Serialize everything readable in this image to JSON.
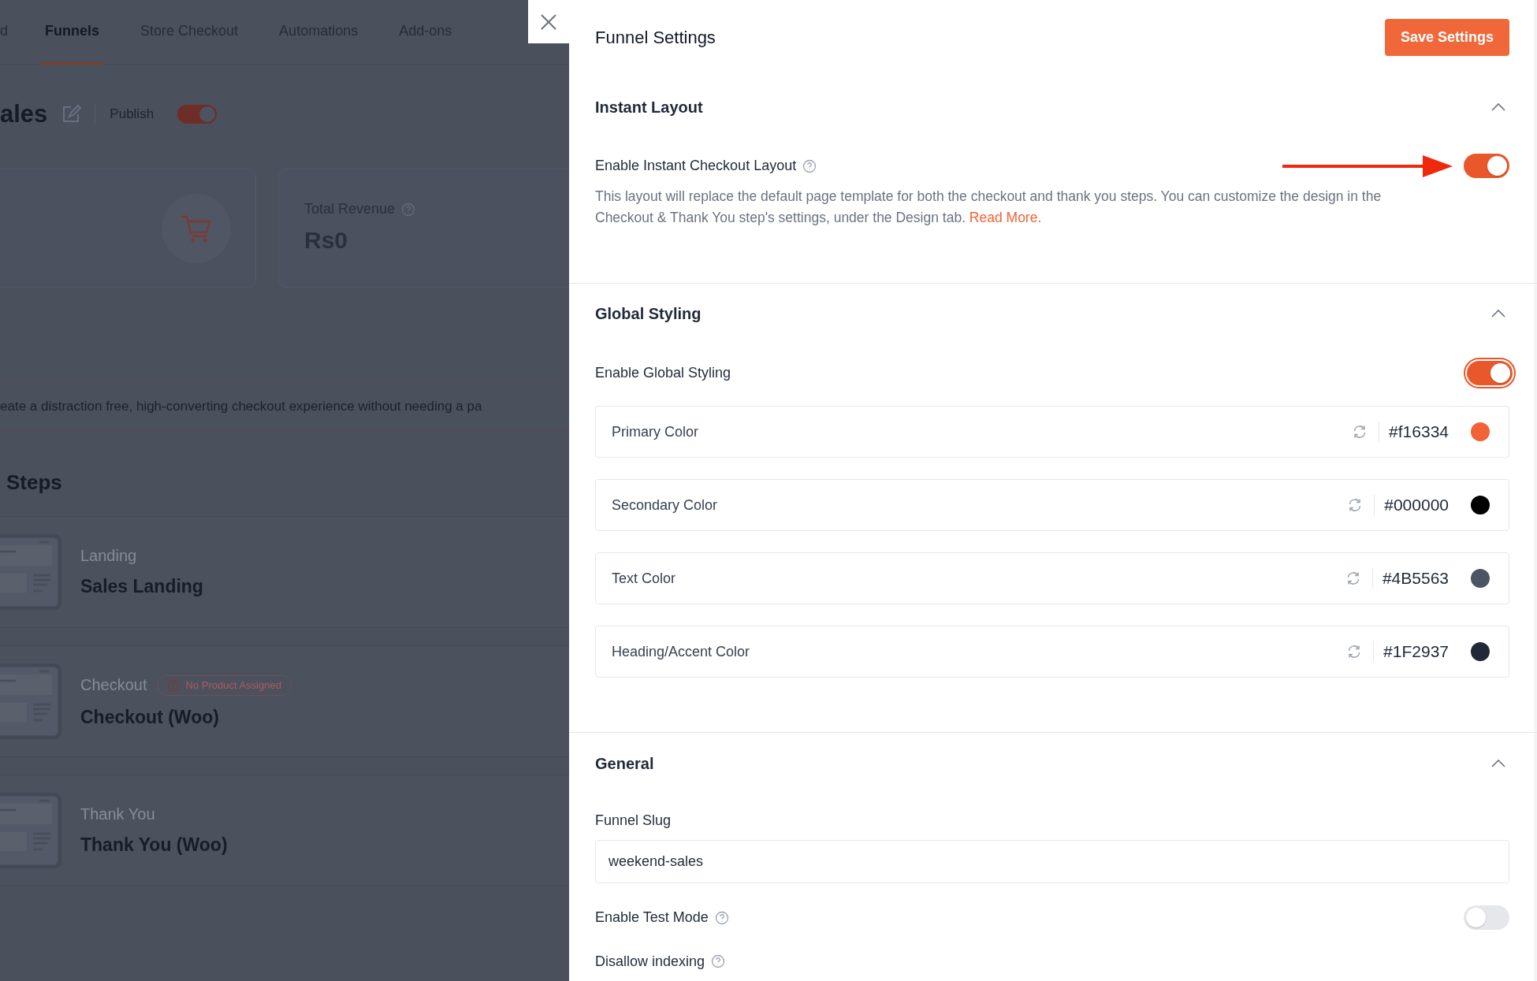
{
  "background_page": {
    "tabs": [
      {
        "label": "d",
        "selected": false
      },
      {
        "label": "Funnels",
        "selected": true
      },
      {
        "label": "Store Checkout",
        "selected": false
      },
      {
        "label": "Automations",
        "selected": false
      },
      {
        "label": "Add-ons",
        "selected": false
      }
    ],
    "funnel_title": "ales",
    "publish_label": "Publish",
    "publish_on": true,
    "stats": [
      {
        "label": "Total Revenue",
        "value": "Rs0"
      }
    ],
    "notice": "eate a distraction free, high-converting checkout experience without needing a pa",
    "steps_heading": "Steps",
    "steps": [
      {
        "type": "Landing",
        "name": "Sales Landing"
      },
      {
        "type": "Checkout",
        "badge": "No Product Assigned",
        "name": "Checkout (Woo)"
      },
      {
        "type": "Thank You",
        "name": "Thank You (Woo)"
      }
    ]
  },
  "panel": {
    "title": "Funnel Settings",
    "save_button": "Save Settings",
    "instant_layout": {
      "title": "Instant Layout",
      "expanded": true,
      "toggle_label": "Enable Instant Checkout Layout",
      "on": true,
      "pointer_arrow": true,
      "description": "This layout will replace the default page template for both the checkout and thank you steps. You can customize the design in the Checkout & Thank You step's settings, under the Design tab.",
      "link": "Read More."
    },
    "global_styling": {
      "title": "Global Styling",
      "expanded": true,
      "toggle_label": "Enable Global Styling",
      "on": true,
      "focused": true,
      "colors": [
        {
          "label": "Primary Color",
          "value": "#f16334",
          "color": "#f16334"
        },
        {
          "label": "Secondary Color",
          "value": "#000000",
          "color": "#000000"
        },
        {
          "label": "Text Color",
          "value": "#4B5563",
          "color": "#4b5563"
        },
        {
          "label": "Heading/Accent Color",
          "value": "#1F2937",
          "color": "#1f2937"
        }
      ]
    },
    "general": {
      "title": "General",
      "expanded": true,
      "slug_label": "Funnel Slug",
      "slug_value": "weekend-sales",
      "test_mode_label": "Enable Test Mode",
      "test_mode_on": false,
      "indexing_label": "Disallow indexing"
    }
  }
}
